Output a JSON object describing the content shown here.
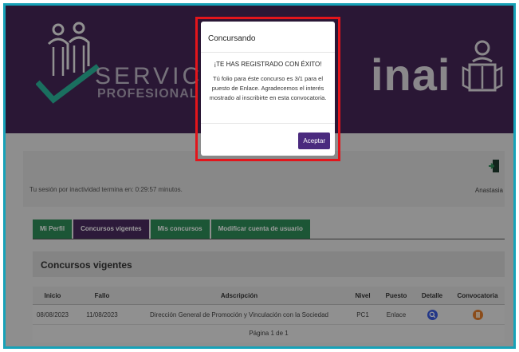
{
  "header": {
    "logo_word": "SERVICIO",
    "logo_sub": "PROFESIONAL INAI",
    "brand": "inai"
  },
  "session": {
    "timeout_text": "Tu sesión por inactividad termina en: 0:29:57 minutos.",
    "user_name": "Anastasia"
  },
  "tabs": [
    {
      "label": "Mi Perfil"
    },
    {
      "label": "Concursos vigentes"
    },
    {
      "label": "Mis concursos"
    },
    {
      "label": "Modificar cuenta de usuario"
    }
  ],
  "panel": {
    "title": "Concursos vigentes"
  },
  "table": {
    "headers": [
      "Inicio",
      "Fallo",
      "Adscripción",
      "Nivel",
      "Puesto",
      "Detalle",
      "Convocatoria"
    ],
    "rows": [
      {
        "inicio": "08/08/2023",
        "fallo": "11/08/2023",
        "adscripcion": "Dirección General de Promoción y Vinculación con la Sociedad",
        "nivel": "PC1",
        "puesto": "Enlace"
      }
    ],
    "pagination": "Página 1 de 1"
  },
  "modal": {
    "title": "Concursando",
    "heading": "¡TE HAS REGISTRADO CON ÉXITO!",
    "body": "Tú folio para éste concurso es 3/1 para el puesto de Enlace. Agradecemos el interés mostrado al inscribirte en esta convocatoria.",
    "accept_label": "Aceptar"
  },
  "colors": {
    "header_purple": "#4a2a5e",
    "tab_green": "#2e8b57",
    "accept_purple": "#4a2a7e",
    "highlight_red": "#e3151b",
    "frame_teal": "#17a2b8",
    "detail_blue": "#3b5bdb",
    "convocatoria_orange": "#e07b2a"
  },
  "icons": {
    "logout": "logout-icon",
    "detail": "search-icon",
    "convocatoria": "document-icon"
  }
}
